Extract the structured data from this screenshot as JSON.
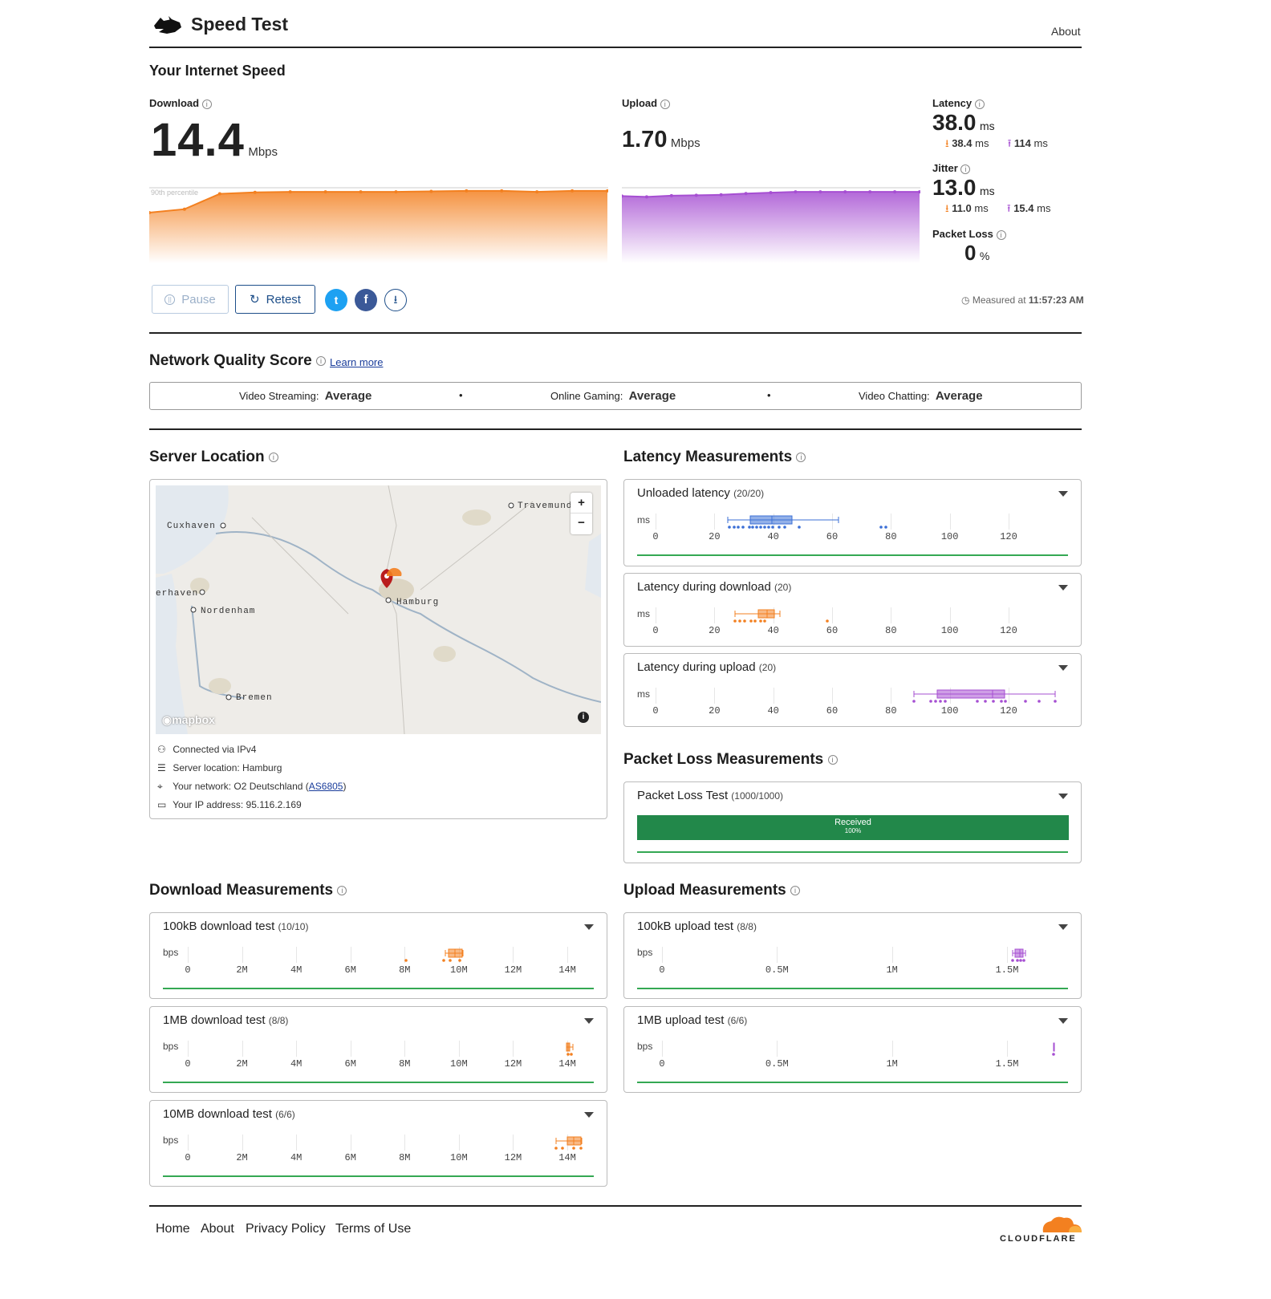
{
  "header": {
    "title": "Speed Test",
    "about": "About"
  },
  "speed": {
    "title": "Your Internet Speed",
    "download": {
      "label": "Download",
      "value": "14.4",
      "unit": "Mbps",
      "percentile_label": "90th percentile"
    },
    "upload": {
      "label": "Upload",
      "value": "1.70",
      "unit": "Mbps"
    },
    "latency": {
      "label": "Latency",
      "value": "38.0",
      "unit": "ms",
      "down": "38.4",
      "up": "114",
      "sub_unit": "ms"
    },
    "jitter": {
      "label": "Jitter",
      "value": "13.0",
      "unit": "ms",
      "down": "11.0",
      "up": "15.4",
      "sub_unit": "ms"
    },
    "packet_loss": {
      "label": "Packet Loss",
      "value": "0",
      "unit": "%"
    },
    "measured_prefix": "Measured at",
    "measured_time": "11:57:23 AM"
  },
  "buttons": {
    "pause": "Pause",
    "retest": "Retest"
  },
  "quality": {
    "title": "Network Quality Score",
    "learn_more": "Learn more",
    "items": [
      {
        "label": "Video Streaming:",
        "value": "Average"
      },
      {
        "label": "Online Gaming:",
        "value": "Average"
      },
      {
        "label": "Video Chatting:",
        "value": "Average"
      }
    ]
  },
  "server": {
    "title": "Server Location",
    "map_labels": {
      "cuxhaven": "Cuxhaven",
      "bremerhaven": "erhaven",
      "nordenham": "Nordenham",
      "hamburg": "Hamburg",
      "bremen": "Bremen",
      "travemunde": "Travemund",
      "logo": "mapbox"
    },
    "details": [
      {
        "icon": "network-icon",
        "text": "Connected via IPv4"
      },
      {
        "icon": "server-icon",
        "text": "Server location: Hamburg"
      },
      {
        "icon": "location-pin-icon",
        "text": "Your network: O2 Deutschland (",
        "link": "AS6805",
        "suffix": ")"
      },
      {
        "icon": "id-card-icon",
        "text": "Your IP address: 95.116.2.169"
      }
    ]
  },
  "latency_measurements": {
    "title": "Latency Measurements",
    "unit": "ms",
    "ticks": [
      "0",
      "20",
      "40",
      "60",
      "80",
      "100",
      "120"
    ],
    "cards": [
      {
        "title": "Unloaded latency",
        "count": "(20/20)"
      },
      {
        "title": "Latency during download",
        "count": "(20)"
      },
      {
        "title": "Latency during upload",
        "count": "(20)"
      }
    ]
  },
  "packet_loss_measurements": {
    "title": "Packet Loss Measurements",
    "card_title": "Packet Loss Test",
    "count": "(1000/1000)",
    "bar_label": "Received",
    "bar_pct": "100%",
    "received_fraction": 1.0
  },
  "download_measurements": {
    "title": "Download Measurements",
    "unit": "bps",
    "ticks": [
      "0",
      "2M",
      "4M",
      "6M",
      "8M",
      "10M",
      "12M",
      "14M"
    ],
    "cards": [
      {
        "title": "100kB download test",
        "count": "(10/10)"
      },
      {
        "title": "1MB download test",
        "count": "(8/8)"
      },
      {
        "title": "10MB download test",
        "count": "(6/6)"
      }
    ]
  },
  "upload_measurements": {
    "title": "Upload Measurements",
    "unit": "bps",
    "ticks": [
      "0",
      "0.5M",
      "1M",
      "1.5M"
    ],
    "cards": [
      {
        "title": "100kB upload test",
        "count": "(8/8)"
      },
      {
        "title": "1MB upload test",
        "count": "(6/6)"
      }
    ]
  },
  "footer": {
    "links": [
      "Home",
      "About",
      "Privacy Policy",
      "Terms of Use"
    ],
    "brand": "CLOUDFLARE"
  },
  "colors": {
    "download": "#f38020",
    "upload": "#a64fd2",
    "latency": "#3b6fd6",
    "green": "#22884a"
  },
  "chart_data": [
    {
      "type": "area",
      "title": "Download",
      "y_unit": "Mbps",
      "values": [
        10.2,
        10.9,
        14.0,
        14.3,
        14.4,
        14.4,
        14.4,
        14.4,
        14.5,
        14.6,
        14.6,
        14.4,
        14.6,
        14.6
      ]
    },
    {
      "type": "area",
      "title": "Upload",
      "y_unit": "Mbps",
      "values": [
        1.6,
        1.58,
        1.61,
        1.62,
        1.63,
        1.66,
        1.68,
        1.7,
        1.7,
        1.7,
        1.7,
        1.7,
        1.7
      ]
    }
  ]
}
